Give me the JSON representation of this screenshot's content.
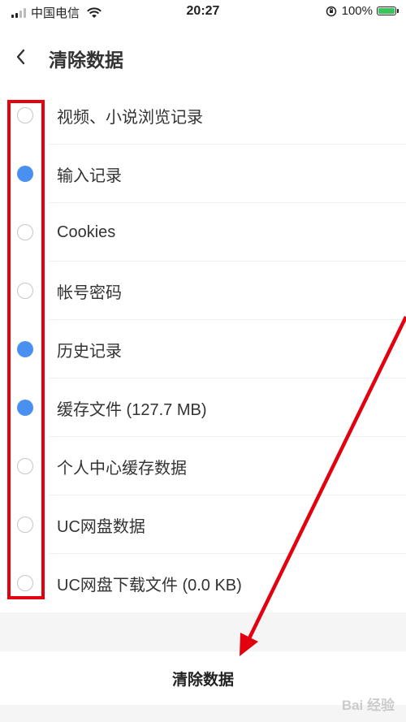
{
  "status_bar": {
    "carrier": "中国电信",
    "time": "20:27",
    "battery": "100%"
  },
  "header": {
    "title": "清除数据"
  },
  "options": [
    {
      "label": "视频、小说浏览记录",
      "checked": false
    },
    {
      "label": "输入记录",
      "checked": true
    },
    {
      "label": "Cookies",
      "checked": false
    },
    {
      "label": "帐号密码",
      "checked": false
    },
    {
      "label": "历史记录",
      "checked": true
    },
    {
      "label": "缓存文件 (127.7 MB)",
      "checked": true
    },
    {
      "label": "个人中心缓存数据",
      "checked": false
    },
    {
      "label": "UC网盘数据",
      "checked": false
    },
    {
      "label": "UC网盘下载文件 (0.0 KB)",
      "checked": false
    }
  ],
  "clear_button": {
    "label": "清除数据"
  },
  "watermark": "Bai 经验",
  "colors": {
    "accent": "#4a90f0",
    "annotation": "#e3000f"
  }
}
